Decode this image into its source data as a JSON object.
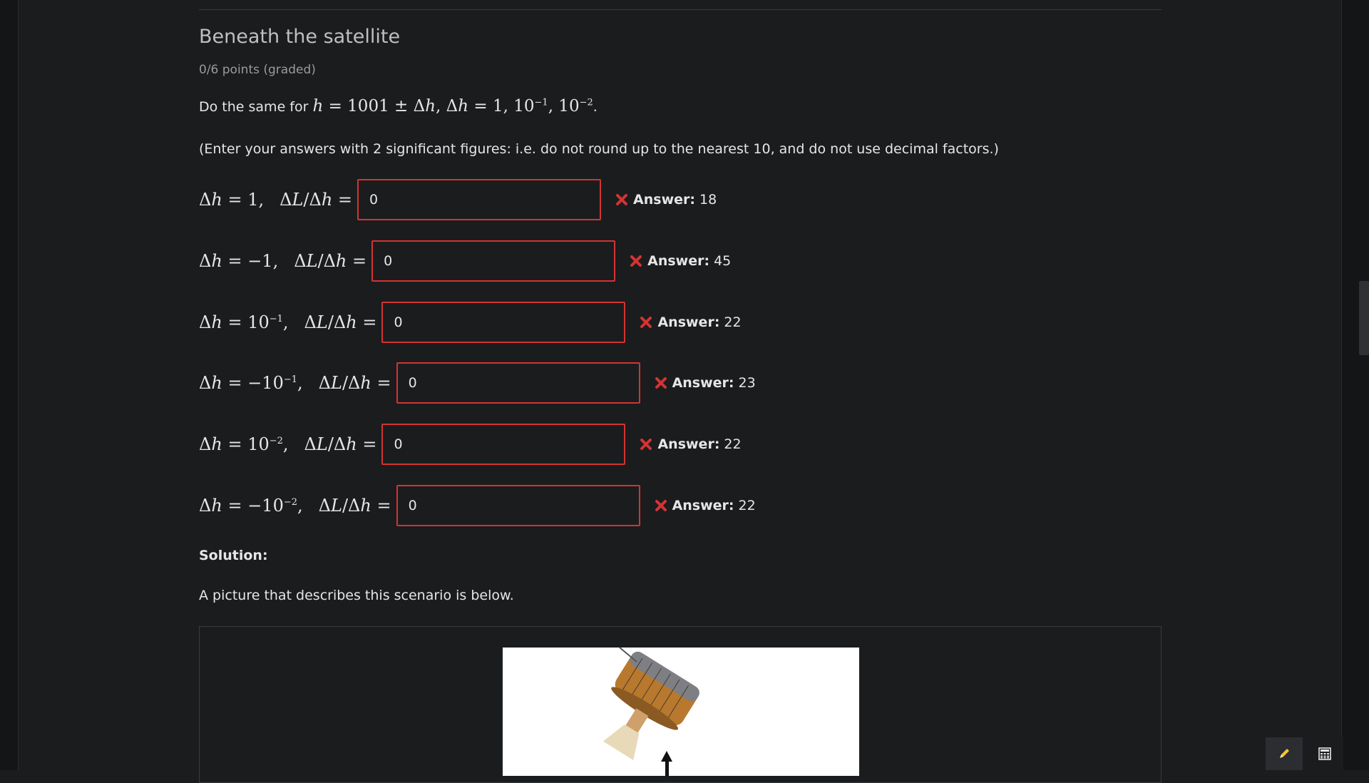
{
  "question": {
    "title": "Beneath the satellite",
    "points": "0/6 points (graded)",
    "intro_prefix": "Do the same for ",
    "instructions": "(Enter your answers with 2 significant figures: i.e. do not round up to the nearest 10, and do not use decimal factors.)"
  },
  "rows": [
    {
      "dh": "1",
      "value": "0",
      "answer_label": "Answer:",
      "answer": "18"
    },
    {
      "dh": "−1",
      "value": "0",
      "answer_label": "Answer:",
      "answer": "45"
    },
    {
      "dh_base": "10",
      "dh_exp": "−1",
      "value": "0",
      "answer_label": "Answer:",
      "answer": "22"
    },
    {
      "dh_base": "−10",
      "dh_exp": "−1",
      "value": "0",
      "answer_label": "Answer:",
      "answer": "23"
    },
    {
      "dh_base": "10",
      "dh_exp": "−2",
      "value": "0",
      "answer_label": "Answer:",
      "answer": "22"
    },
    {
      "dh_base": "−10",
      "dh_exp": "−2",
      "value": "0",
      "answer_label": "Answer:",
      "answer": "22"
    }
  ],
  "solution": {
    "heading": "Solution:",
    "text": "A picture that describes this scenario is below."
  },
  "icons": {
    "incorrect": "x-icon",
    "pencil": "pencil-icon",
    "calculator": "calculator-icon"
  },
  "colors": {
    "error": "#d43333",
    "pencil": "#f2c531"
  }
}
